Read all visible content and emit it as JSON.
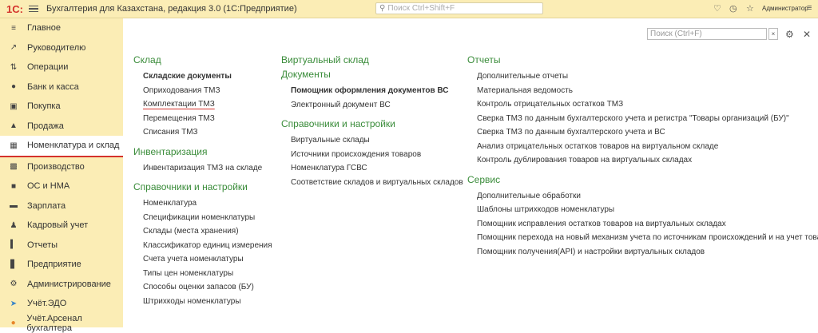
{
  "app": {
    "logo": "1С:",
    "title": "Бухгалтерия для Казахстана, редакция 3.0  (1С:Предприятие)",
    "search_placeholder": "Поиск Ctrl+Shift+F",
    "user": "Администратор"
  },
  "sidebar": {
    "items": [
      {
        "label": "Главное",
        "icon": "menu-icon"
      },
      {
        "label": "Руководителю",
        "icon": "trend-icon"
      },
      {
        "label": "Операции",
        "icon": "operations-icon"
      },
      {
        "label": "Банк и касса",
        "icon": "bank-icon"
      },
      {
        "label": "Покупка",
        "icon": "cart-icon"
      },
      {
        "label": "Продажа",
        "icon": "bag-icon"
      },
      {
        "label": "Номенклатура и склад",
        "icon": "grid-icon"
      },
      {
        "label": "Производство",
        "icon": "factory-icon"
      },
      {
        "label": "ОС и НМА",
        "icon": "truck-icon"
      },
      {
        "label": "Зарплата",
        "icon": "wallet-icon"
      },
      {
        "label": "Кадровый учет",
        "icon": "people-icon"
      },
      {
        "label": "Отчеты",
        "icon": "chart-icon"
      },
      {
        "label": "Предприятие",
        "icon": "building-icon"
      },
      {
        "label": "Администрирование",
        "icon": "gear-icon"
      },
      {
        "label": "Учёт.ЭДО",
        "icon": "send-icon"
      },
      {
        "label": "Учёт.Арсенал бухгалтера",
        "icon": "arsenal-icon"
      }
    ]
  },
  "content": {
    "search_placeholder": "Поиск (Ctrl+F)",
    "col1": {
      "sec1_title": "Склад",
      "sec1_items": [
        "Складские документы",
        "Оприходования ТМЗ",
        "Комплектации ТМЗ",
        "Перемещения ТМЗ",
        "Списания ТМЗ"
      ],
      "sec2_title": "Инвентаризация",
      "sec2_items": [
        "Инвентаризация ТМЗ на складе"
      ],
      "sec3_title": "Справочники и настройки",
      "sec3_items": [
        "Номенклатура",
        "Спецификации номенклатуры",
        "Склады (места хранения)",
        "Классификатор единиц измерения",
        "Счета учета номенклатуры",
        "Типы цен номенклатуры",
        "Способы оценки запасов (БУ)",
        "Штрихкоды номенклатуры"
      ]
    },
    "col2": {
      "sec1_title": "Виртуальный склад",
      "sec2_title": "Документы",
      "sec2_items": [
        "Помощник оформления документов ВС",
        "Электронный документ ВС"
      ],
      "sec3_title": "Справочники и настройки",
      "sec3_items": [
        "Виртуальные склады",
        "Источники происхождения товаров",
        "Номенклатура ГСВС",
        "Соответствие складов и виртуальных складов"
      ]
    },
    "col3": {
      "sec1_title": "Отчеты",
      "sec1_items": [
        "Дополнительные отчеты",
        "Материальная ведомость",
        "Контроль отрицательных остатков ТМЗ",
        "Сверка ТМЗ по данным бухгалтерского учета и регистра \"Товары организаций (БУ)\"",
        "Сверка ТМЗ по данным бухгалтерского учета и ВС",
        "Анализ отрицательных остатков товаров на виртуальном складе",
        "Контроль дублирования товаров на виртуальных складах"
      ],
      "sec2_title": "Сервис",
      "sec2_items": [
        "Дополнительные обработки",
        "Шаблоны штрихкодов номенклатуры",
        "Помощник исправления остатков товаров на виртуальных складах",
        "Помощник перехода на новый механизм учета по источникам происхождений и на учет товаров ВС",
        "Помощник получения(API) и настройки виртуальных складов"
      ]
    }
  }
}
